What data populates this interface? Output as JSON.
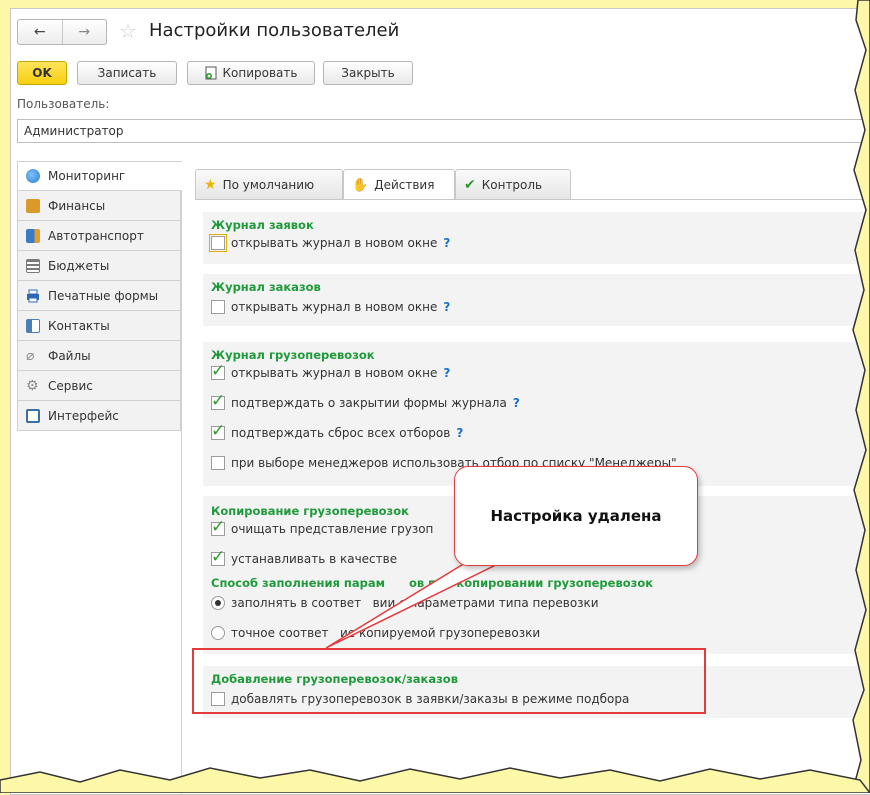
{
  "window": {
    "nav_back": "←",
    "nav_forward": "→",
    "title": "Настройки пользователей"
  },
  "toolbar": {
    "ok": "OK",
    "save": "Записать",
    "copy": "Копировать",
    "close": "Закрыть"
  },
  "user": {
    "label": "Пользователь:",
    "value": "Администратор"
  },
  "sidebar": {
    "items": [
      {
        "label": "Мониторинг",
        "icon": "globe-icon",
        "color": "#2c7fc9"
      },
      {
        "label": "Финансы",
        "icon": "calculator-icon",
        "color": "#d99a2b"
      },
      {
        "label": "Автотранспорт",
        "icon": "truck-icon",
        "color": "#3a7bc8"
      },
      {
        "label": "Бюджеты",
        "icon": "ledger-icon",
        "color": "#7a7a7a"
      },
      {
        "label": "Печатные формы",
        "icon": "printer-icon",
        "color": "#2a69b5"
      },
      {
        "label": "Контакты",
        "icon": "contact-card-icon",
        "color": "#4a7fb5"
      },
      {
        "label": "Файлы",
        "icon": "paperclip-icon",
        "color": "#8a8a8a"
      },
      {
        "label": "Сервис",
        "icon": "gear-icon",
        "color": "#8a8a8a"
      },
      {
        "label": "Интерфейс",
        "icon": "interface-icon",
        "color": "#3a6ea5"
      }
    ]
  },
  "tabs": [
    {
      "label": "По умолчанию",
      "icon": "star-icon"
    },
    {
      "label": "Действия",
      "icon": "hand-icon"
    },
    {
      "label": "Контроль",
      "icon": "checkmark-icon"
    }
  ],
  "groups": {
    "g1": {
      "title": "Журнал заявок",
      "items": [
        {
          "label": "открывать журнал в новом окне",
          "checked": false,
          "help": "?"
        }
      ]
    },
    "g2": {
      "title": "Журнал заказов",
      "items": [
        {
          "label": "открывать журнал в новом окне",
          "checked": false,
          "help": "?"
        }
      ]
    },
    "g3": {
      "title": "Журнал грузоперевозок",
      "items": [
        {
          "label": "открывать журнал в новом окне",
          "checked": true,
          "help": "?"
        },
        {
          "label": "подтверждать о закрытии формы журнала",
          "checked": true,
          "help": "?"
        },
        {
          "label": "подтверждать сброс всех отборов",
          "checked": true,
          "help": "?"
        },
        {
          "label": "при выборе менеджеров использовать отбор по списку \"Менеджеры\"",
          "checked": false
        }
      ]
    },
    "g4": {
      "title": "Копирование грузоперевозок",
      "items": [
        {
          "label": "очищать представление грузоп",
          "checked": true
        },
        {
          "label": "устанавливать в качестве",
          "checked": true
        }
      ]
    },
    "g5": {
      "title": "Способ заполнения парам      ов при копировании грузоперевозок",
      "options": [
        {
          "label": "заполнять в соответ   вии с параметрами типа перевозки",
          "selected": true
        },
        {
          "label": "точное соответ   ие копируемой грузоперевозки",
          "selected": false
        }
      ]
    },
    "g6": {
      "title": "Добавление грузоперевозок/заказов",
      "items": [
        {
          "label": "добавлять грузоперевозок в заявки/заказы в режиме подбора",
          "checked": false
        }
      ]
    }
  },
  "callout": {
    "text": "Настройка удалена"
  },
  "colors": {
    "accent_ok": "#f5cf10",
    "group_title": "#1f9a3b",
    "help": "#1a6fd0",
    "highlight": "#e33b3b",
    "background": "#fdf7a8"
  }
}
